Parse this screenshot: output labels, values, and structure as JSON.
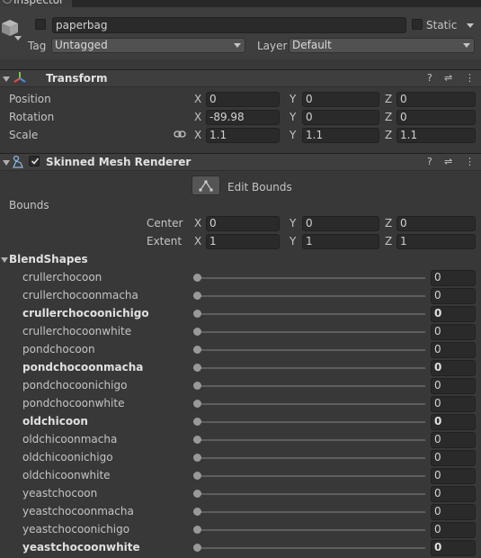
{
  "tab": {
    "title": "Inspector"
  },
  "gameobject": {
    "name": "paperbag",
    "static_label": "Static",
    "tag_label": "Tag",
    "tag_value": "Untagged",
    "layer_label": "Layer",
    "layer_value": "Default"
  },
  "transform": {
    "title": "Transform",
    "rows": [
      {
        "label": "Position",
        "x": "0",
        "y": "0",
        "z": "0"
      },
      {
        "label": "Rotation",
        "x": "-89.98",
        "y": "0",
        "z": "0"
      },
      {
        "label": "Scale",
        "x": "1.1",
        "y": "1.1",
        "z": "1.1"
      }
    ],
    "axis_x": "X",
    "axis_y": "Y",
    "axis_z": "Z"
  },
  "renderer": {
    "title": "Skinned Mesh Renderer",
    "edit_bounds_label": "Edit Bounds",
    "bounds_label": "Bounds",
    "center": {
      "label": "Center",
      "x": "0",
      "y": "0",
      "z": "0"
    },
    "extent": {
      "label": "Extent",
      "x": "1",
      "y": "1",
      "z": "1"
    },
    "blendshapes_label": "BlendShapes",
    "blendshapes": [
      {
        "name": "crullerchocoon",
        "value": "0",
        "bold": false
      },
      {
        "name": "crullerchocoonmacha",
        "value": "0",
        "bold": false
      },
      {
        "name": "crullerchocoonichigo",
        "value": "0",
        "bold": true
      },
      {
        "name": "crullerchocoonwhite",
        "value": "0",
        "bold": false
      },
      {
        "name": "pondchocoon",
        "value": "0",
        "bold": false
      },
      {
        "name": "pondchocoonmacha",
        "value": "0",
        "bold": true
      },
      {
        "name": "pondchocoonichigo",
        "value": "0",
        "bold": false
      },
      {
        "name": "pondchocoonwhite",
        "value": "0",
        "bold": false
      },
      {
        "name": "oldchicoon",
        "value": "0",
        "bold": true
      },
      {
        "name": "oldchicoonmacha",
        "value": "0",
        "bold": false
      },
      {
        "name": "oldchicoonichigo",
        "value": "0",
        "bold": false
      },
      {
        "name": "oldchicoonwhite",
        "value": "0",
        "bold": false
      },
      {
        "name": "yeastchocoon",
        "value": "0",
        "bold": false
      },
      {
        "name": "yeastchocoonmacha",
        "value": "0",
        "bold": false
      },
      {
        "name": "yeastchocoonichigo",
        "value": "0",
        "bold": false
      },
      {
        "name": "yeastchocoonwhite",
        "value": "0",
        "bold": true
      }
    ]
  }
}
